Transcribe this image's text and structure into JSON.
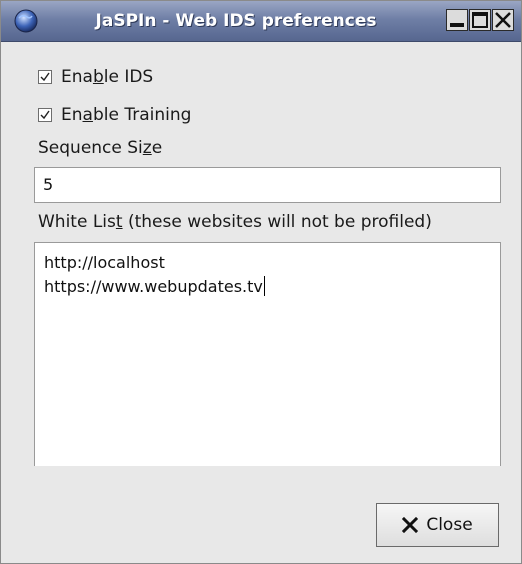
{
  "window": {
    "title": "JaSPIn - Web IDS preferences",
    "icons": {
      "app": "globe-icon",
      "minimize": "minimize-icon",
      "maximize": "maximize-icon",
      "close": "close-icon"
    },
    "colors": {
      "titlebar": "#6f7fa6",
      "background": "#e8e8e8"
    }
  },
  "enable_ids": {
    "label_pre": "Ena",
    "label_mnemonic": "b",
    "label_post": "le IDS",
    "checked": true
  },
  "enable_training": {
    "label_pre": "En",
    "label_mnemonic": "a",
    "label_post": "ble Training",
    "checked": true
  },
  "sequence_size": {
    "label_pre": "Sequence Si",
    "label_mnemonic": "z",
    "label_post": "e",
    "value": "5"
  },
  "white_list": {
    "label_pre": "White Lis",
    "label_mnemonic": "t",
    "label_post": " (these websites will not be profiled)",
    "entries": [
      "http://localhost",
      "https://www.webupdates.tv"
    ]
  },
  "close_button": {
    "label": "Close",
    "icon": "x-icon"
  }
}
